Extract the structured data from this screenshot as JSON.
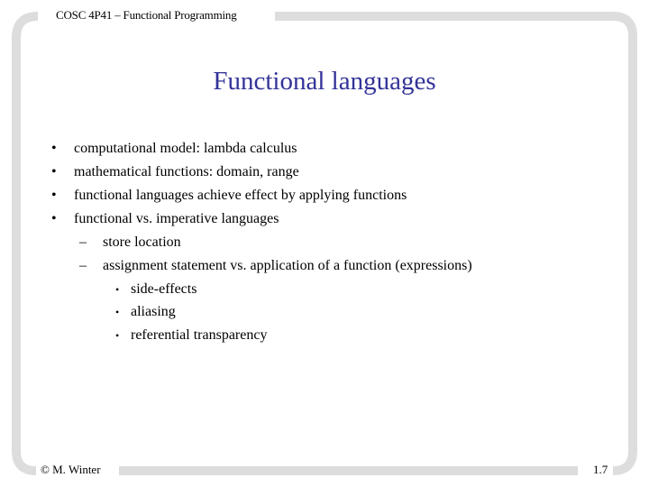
{
  "header": {
    "course": "COSC 4P41 – Functional Programming"
  },
  "slide": {
    "title": "Functional languages",
    "items": [
      {
        "level": 1,
        "marker": "•",
        "text": "computational model: lambda calculus"
      },
      {
        "level": 1,
        "marker": "•",
        "text": "mathematical functions: domain, range"
      },
      {
        "level": 1,
        "marker": "•",
        "text": "functional languages achieve effect by applying functions"
      },
      {
        "level": 1,
        "marker": "•",
        "text": "functional vs. imperative languages"
      },
      {
        "level": 2,
        "marker": "–",
        "text": "store location"
      },
      {
        "level": 2,
        "marker": "–",
        "text": "assignment statement vs. application of a function (expressions)"
      },
      {
        "level": 3,
        "marker": "•",
        "text": "side-effects"
      },
      {
        "level": 3,
        "marker": "•",
        "text": "aliasing"
      },
      {
        "level": 3,
        "marker": "•",
        "text": "referential transparency"
      }
    ]
  },
  "footer": {
    "author": "© M. Winter",
    "page": "1.7"
  },
  "colors": {
    "title": "#333399",
    "frame": "#dddddd",
    "text": "#000000"
  }
}
